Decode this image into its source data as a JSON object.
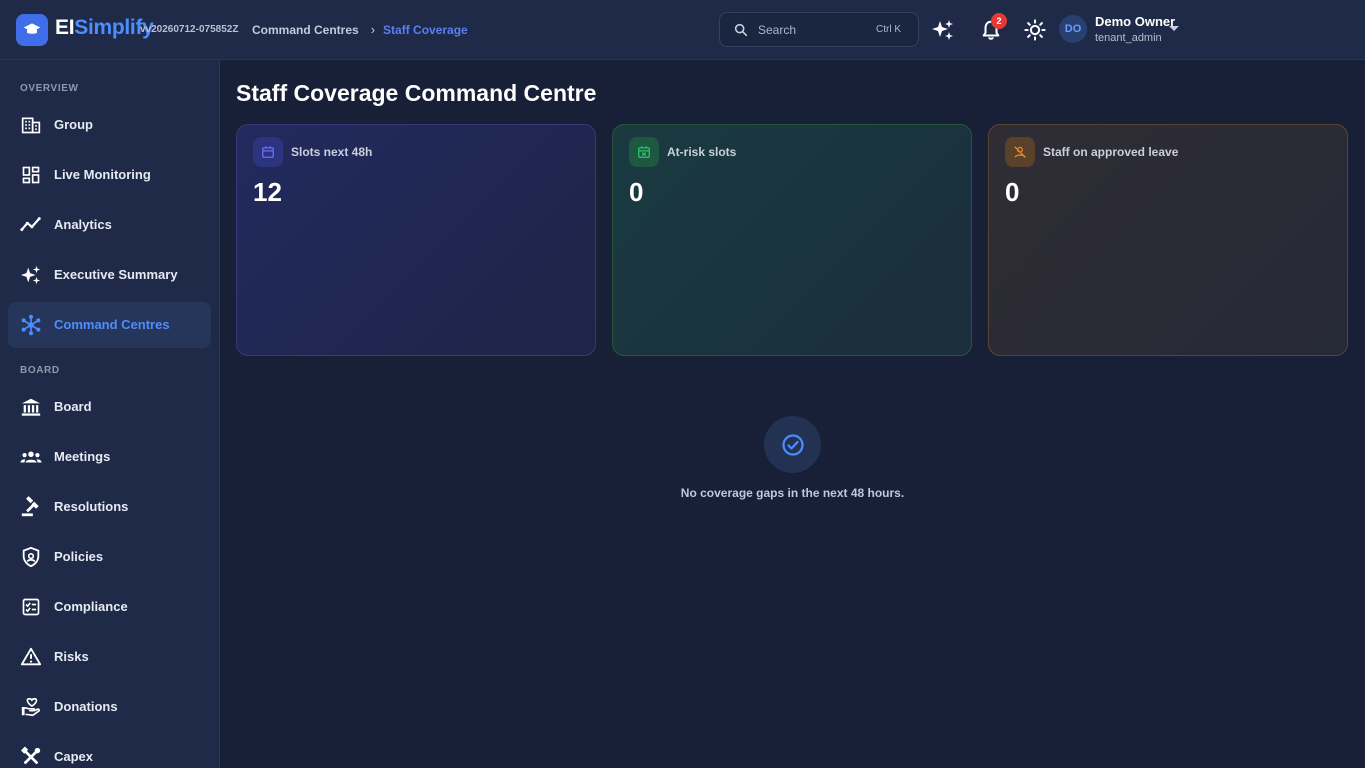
{
  "header": {
    "brand_prefix": "EI",
    "brand_suffix": "Simplify",
    "version": "vv20260712-075852Z",
    "breadcrumb": [
      "Command Centres",
      "Staff Coverage"
    ],
    "search": {
      "placeholder": "Search",
      "shortcut": "Ctrl K"
    },
    "notification_count": "2",
    "user": {
      "initials": "DO",
      "name": "Demo Owner",
      "role": "tenant_admin"
    }
  },
  "sidebar": {
    "sections": [
      {
        "title": "OVERVIEW"
      },
      {
        "title": "BOARD"
      }
    ],
    "items": [
      {
        "label": "Group",
        "icon": "building-icon"
      },
      {
        "label": "Live Monitoring",
        "icon": "dashboard-icon"
      },
      {
        "label": "Analytics",
        "icon": "trend-icon"
      },
      {
        "label": "Executive Summary",
        "icon": "sparkle-icon"
      },
      {
        "label": "Command Centres",
        "icon": "hub-icon",
        "active": true
      },
      {
        "label": "Board",
        "icon": "bank-icon"
      },
      {
        "label": "Meetings",
        "icon": "group-icon"
      },
      {
        "label": "Resolutions",
        "icon": "gavel-icon"
      },
      {
        "label": "Policies",
        "icon": "shield-icon"
      },
      {
        "label": "Compliance",
        "icon": "checklist-icon"
      },
      {
        "label": "Risks",
        "icon": "warning-icon"
      },
      {
        "label": "Donations",
        "icon": "donation-icon"
      },
      {
        "label": "Capex",
        "icon": "tools-icon"
      }
    ]
  },
  "main": {
    "title": "Staff Coverage Command Centre",
    "cards": [
      {
        "label": "Slots next 48h",
        "value": "12",
        "icon": "calendar-icon",
        "accent": "#6b6ff5"
      },
      {
        "label": "At-risk slots",
        "value": "0",
        "icon": "calendar-x-icon",
        "accent": "#2ec26b"
      },
      {
        "label": "Staff on approved leave",
        "value": "0",
        "icon": "person-off-icon",
        "accent": "#e58a2b"
      }
    ],
    "empty_state": {
      "message": "No coverage gaps in the next 48 hours.",
      "icon": "check-circle-icon"
    }
  },
  "colors": {
    "accent": "#4f8cff",
    "background": "#172036",
    "panel": "#1e2a47"
  }
}
